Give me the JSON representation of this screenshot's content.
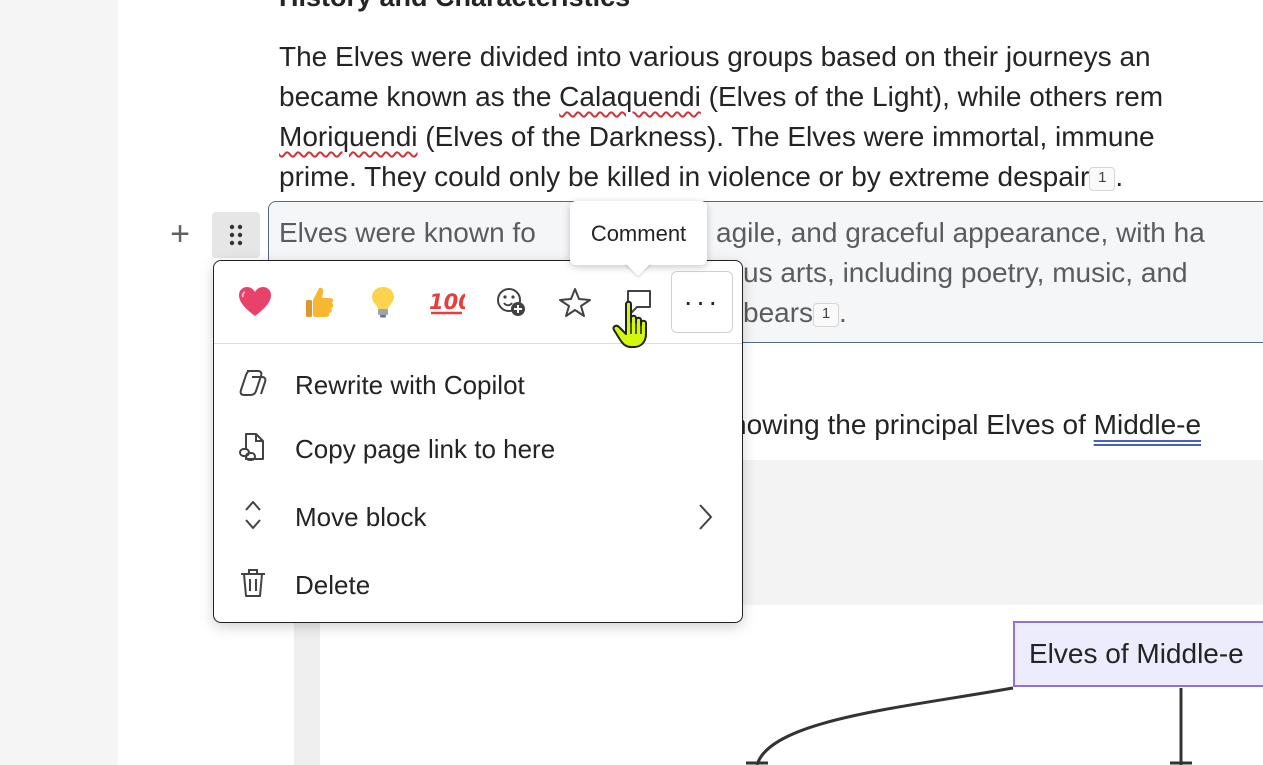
{
  "document": {
    "heading": "History and Characteristics",
    "para1": {
      "l1": "The Elves were divided into various groups based on their journeys an",
      "l2a": "became known as the ",
      "l2b": "Calaquendi",
      "l2c": " (Elves of the Light), while others rem",
      "l3a": "Moriquendi",
      "l3b": " (Elves of the Darkness). The Elves were immortal, immune",
      "l4": "prime. They could only be killed in violence or by extreme despair",
      "footnote": "1",
      "end": "."
    },
    "selected": {
      "l1a": "Elves were known fo",
      "l1b": "agile, and graceful appearance, with ha",
      "l2": "us arts, including poetry, music, and",
      "l3": "bears",
      "footnote": "1",
      "end": "."
    },
    "para3": {
      "prefix": "howing the principal Elves of ",
      "link": "Middle-e"
    },
    "diagram_node": "Elves of Middle-e"
  },
  "tooltip": "Comment",
  "reactions": [
    "heart",
    "thumbs-up",
    "lightbulb",
    "hundred",
    "add-reaction",
    "sparkle-star",
    "comment"
  ],
  "more_label": "···",
  "menu": {
    "items": [
      {
        "label": "Rewrite with Copilot",
        "icon": "copilot-icon"
      },
      {
        "label": "Copy page link to here",
        "icon": "page-link-icon"
      },
      {
        "label": "Move block",
        "icon": "move-icon"
      },
      {
        "label": "Delete",
        "icon": "trash-icon"
      }
    ]
  },
  "colors": {
    "accent_border": "#536a86",
    "spell_error": "#d13438",
    "diagram_fill": "#ececfd",
    "diagram_border": "#9370db",
    "cursor": "#d4f70e"
  }
}
